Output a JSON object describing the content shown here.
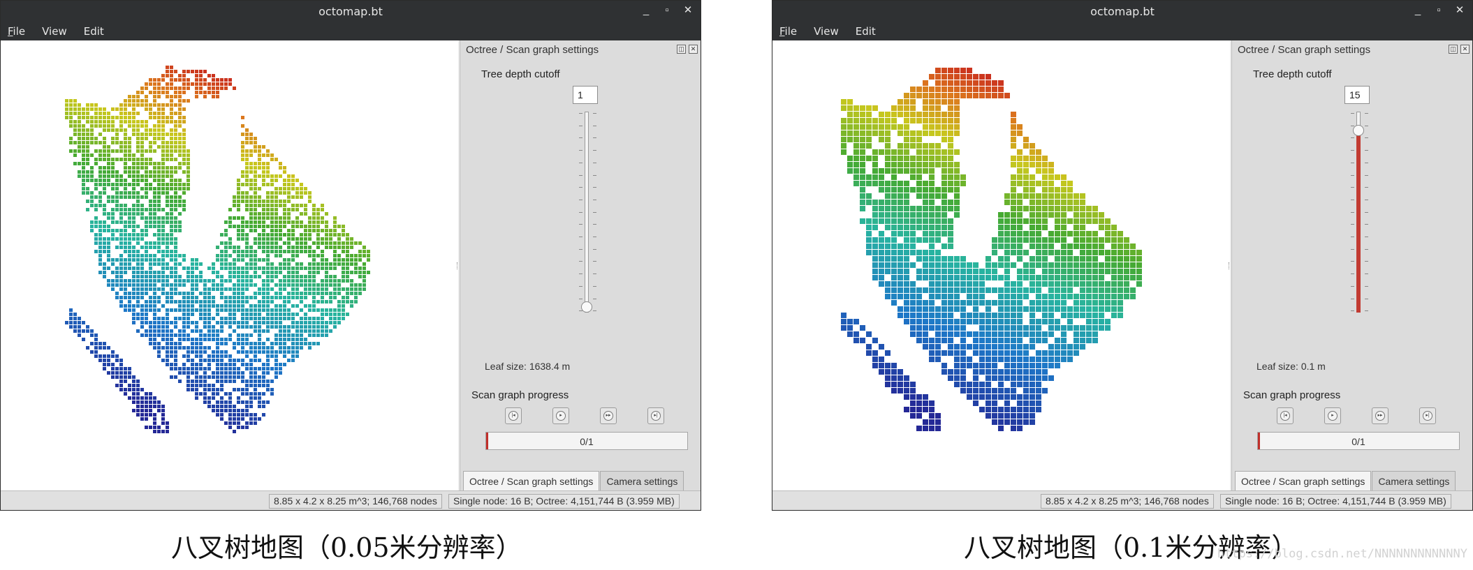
{
  "colors": {
    "accent": "#c0302b",
    "titlebar": "#2f3133",
    "panel": "#dcdcdc"
  },
  "icons": {
    "nav": [
      "skip-back-icon",
      "play-icon",
      "step-forward-icon",
      "skip-end-icon"
    ],
    "window": [
      "minimize-icon",
      "maximize-icon",
      "close-icon"
    ]
  },
  "left": {
    "title": "octomap.bt",
    "menu": [
      "File",
      "View",
      "Edit"
    ],
    "window_buttons": [
      "_",
      "▫",
      "✕"
    ],
    "panel_title": "Octree / Scan graph settings",
    "depth_label": "Tree depth cutoff",
    "depth_value": "1",
    "depth_fraction": 0.0,
    "leaf_label": "Leaf size:  1638.4 m",
    "scan_label": "Scan graph progress",
    "progress_text": "0/1",
    "tabs": [
      "Octree / Scan graph settings",
      "Camera settings"
    ],
    "status_left": "8.85 x 4.2 x 8.25 m^3; 146,768 nodes",
    "status_right": "Single node: 16 B; Octree: 4,151,744 B (3.959 MB)"
  },
  "right": {
    "title": "octomap.bt",
    "menu": [
      "File",
      "View",
      "Edit"
    ],
    "window_buttons": [
      "_",
      "▫",
      "✕"
    ],
    "panel_title": "Octree / Scan graph settings",
    "depth_label": "Tree depth cutoff",
    "depth_value": "15",
    "depth_fraction": 0.93,
    "leaf_label": "Leaf size:  0.1 m",
    "scan_label": "Scan graph progress",
    "progress_text": "0/1",
    "tabs": [
      "Octree / Scan graph settings",
      "Camera settings"
    ],
    "status_left": "8.85 x 4.2 x 8.25 m^3; 146,768 nodes",
    "status_right": "Single node: 16 B; Octree: 4,151,744 B (3.959 MB)"
  },
  "captions": {
    "left": "八叉树地图（0.05米分辨率）",
    "right": "八叉树地图（0.1米分辨率）",
    "watermark": "https://blog.csdn.net/NNNNNNNNNNNNY"
  }
}
